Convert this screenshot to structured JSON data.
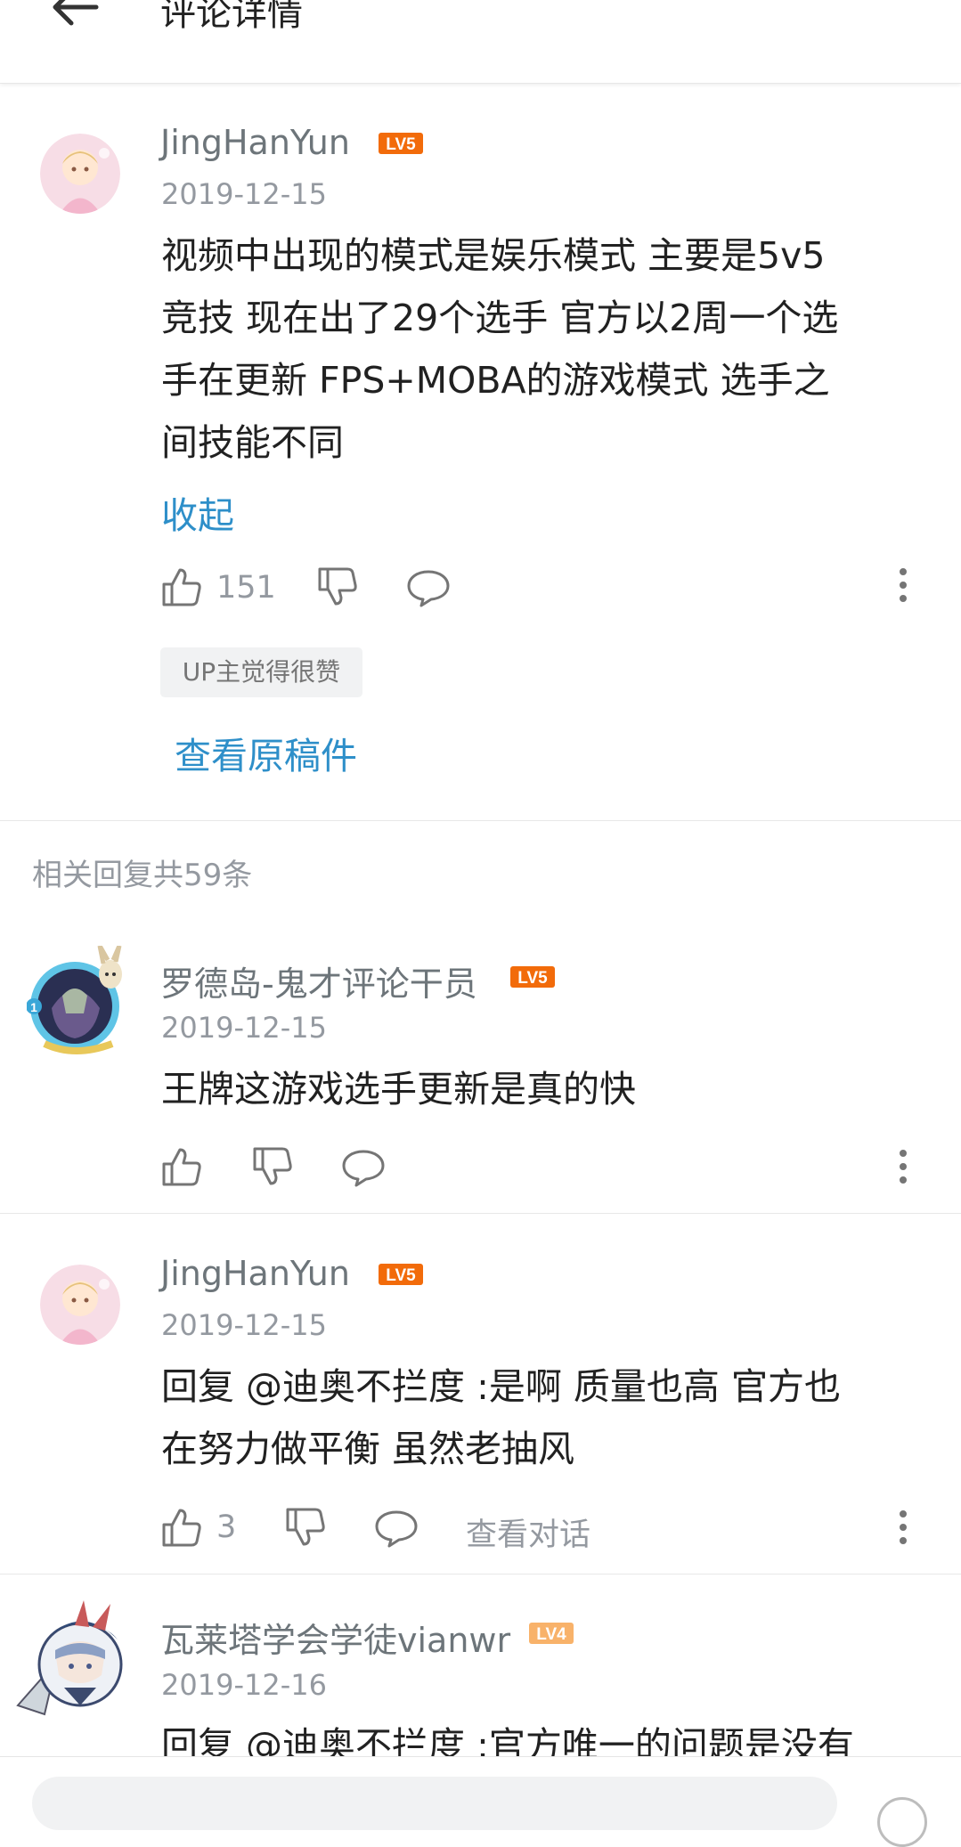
{
  "header": {
    "title": "评论详情"
  },
  "main_comment": {
    "username": "JingHanYun",
    "level": "LV5",
    "date": "2019-12-15",
    "lines": [
      "视频中出现的模式是娱乐模式  主要是5v5",
      "竞技  现在出了29个选手  官方以2周一个选",
      "手在更新  FPS+MOBA的游戏模式  选手之",
      "间技能不同"
    ],
    "collapse_label": "收起",
    "likes": "151",
    "up_badge": "UP主觉得很赞",
    "view_original": "查看原稿件"
  },
  "replies_header": "相关回复共59条",
  "replies": [
    {
      "username": "罗德岛-鬼才评论干员",
      "level": "LV5",
      "date": "2019-12-15",
      "lines": [
        "王牌这游戏选手更新是真的快"
      ]
    },
    {
      "username": "JingHanYun",
      "level": "LV5",
      "date": "2019-12-15",
      "lines": [
        "回复 @迪奥不拦度 :是啊  质量也高  官方也",
        "在努力做平衡  虽然老抽风"
      ],
      "likes": "3",
      "view_conversation": "查看对话"
    },
    {
      "username": "瓦莱塔学会学徒vianwr",
      "level": "LV4",
      "date": "2019-12-16",
      "lines": [
        "回复 @迪奥不拦度 :官方唯一的问题是没有"
      ]
    }
  ],
  "colors": {
    "accent_blue": "#2e8fc9",
    "lv5_orange": "#f26b0a",
    "lv4_orange": "#f8b26a",
    "meta_gray": "#9499a0"
  }
}
